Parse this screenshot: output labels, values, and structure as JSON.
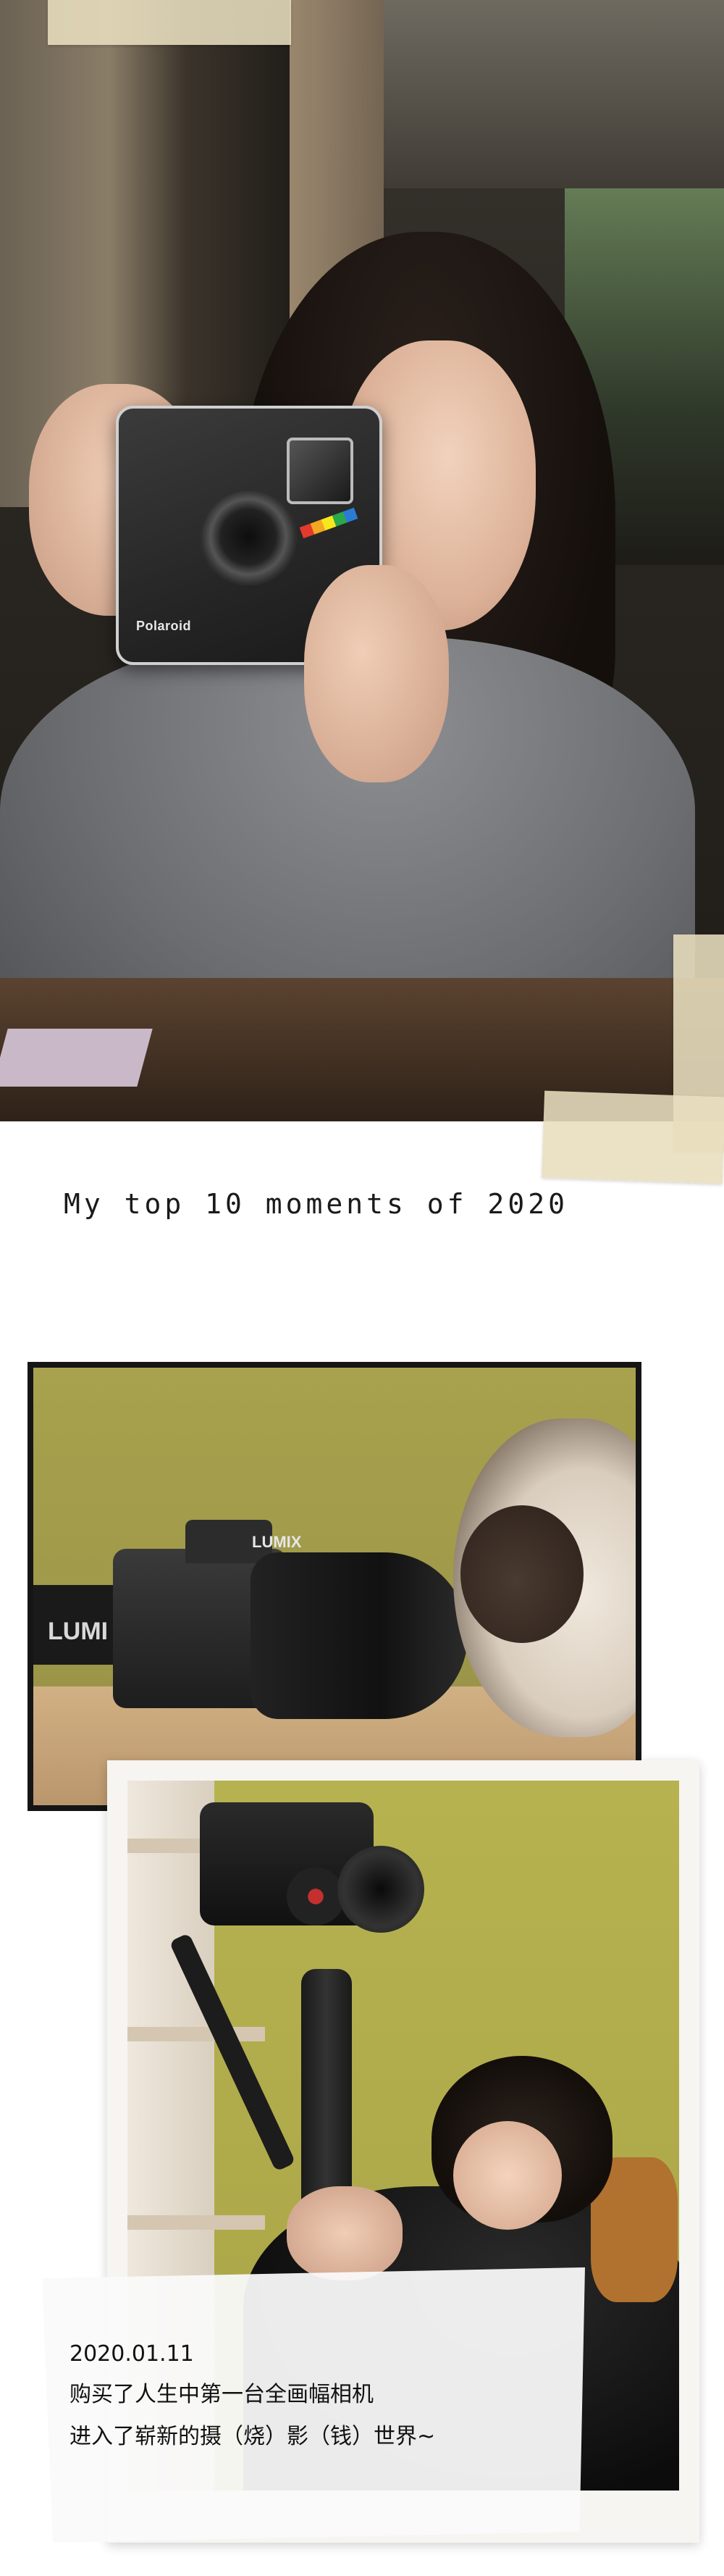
{
  "hero": {
    "camera_brand": "Polaroid"
  },
  "section": {
    "title": "My top 10 moments of 2020"
  },
  "cat_photo": {
    "strap_text": "LUMI",
    "camera_brand": "LUMIX"
  },
  "moment": {
    "date": "2020.01.11",
    "line1": "购买了人生中第一台全画幅相机",
    "line2": "进入了崭新的摄（烧）影（钱）世界~"
  }
}
